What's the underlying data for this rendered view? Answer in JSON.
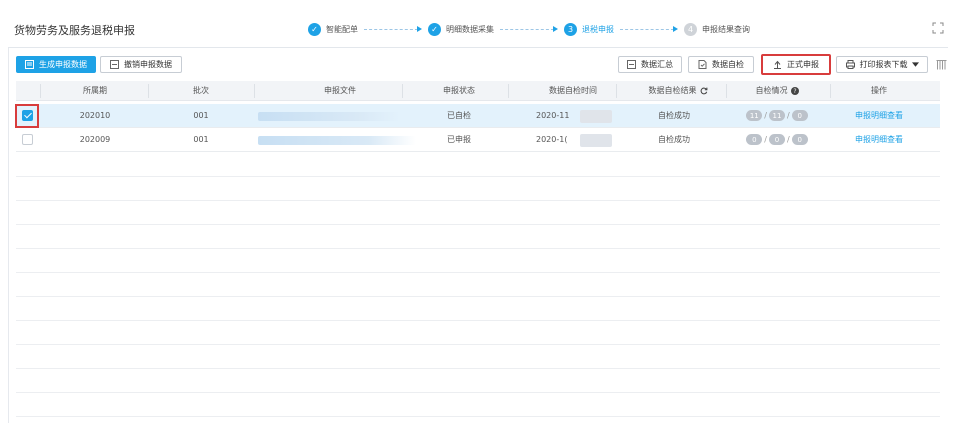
{
  "header": {
    "title": "货物劳务及服务退税申报",
    "steps": [
      {
        "label": "智能配单",
        "state": "done",
        "marker": "✓"
      },
      {
        "label": "明细数据采集",
        "state": "done",
        "marker": "✓"
      },
      {
        "label": "退税申报",
        "state": "active",
        "marker": "3"
      },
      {
        "label": "申报结果查询",
        "state": "todo",
        "marker": "4"
      }
    ]
  },
  "toolbar": {
    "generate_label": "生成申报数据",
    "revoke_label": "撤销申报数据",
    "summary_label": "数据汇总",
    "selfcheck_label": "数据自检",
    "formal_label": "正式申报",
    "print_label": "打印报表下载"
  },
  "table": {
    "columns": [
      "所属期",
      "批次",
      "申报文件",
      "申报状态",
      "数据自检时间",
      "数据自检结果",
      "自检情况",
      "操作"
    ],
    "rows": [
      {
        "period": "202010",
        "batch": "001",
        "status": "已自检",
        "time": "2020-11",
        "result": "自检成功",
        "counts": [
          "11",
          "11",
          "0"
        ],
        "action": "申报明细查看",
        "checked": true
      },
      {
        "period": "202009",
        "batch": "001",
        "status": "已申报",
        "time": "2020-1(",
        "result": "自检成功",
        "counts": [
          "0",
          "0",
          "0"
        ],
        "action": "申报明细查看",
        "checked": false
      }
    ]
  },
  "colors": {
    "accent": "#1ea2e6",
    "highlight": "#d83c3c"
  }
}
